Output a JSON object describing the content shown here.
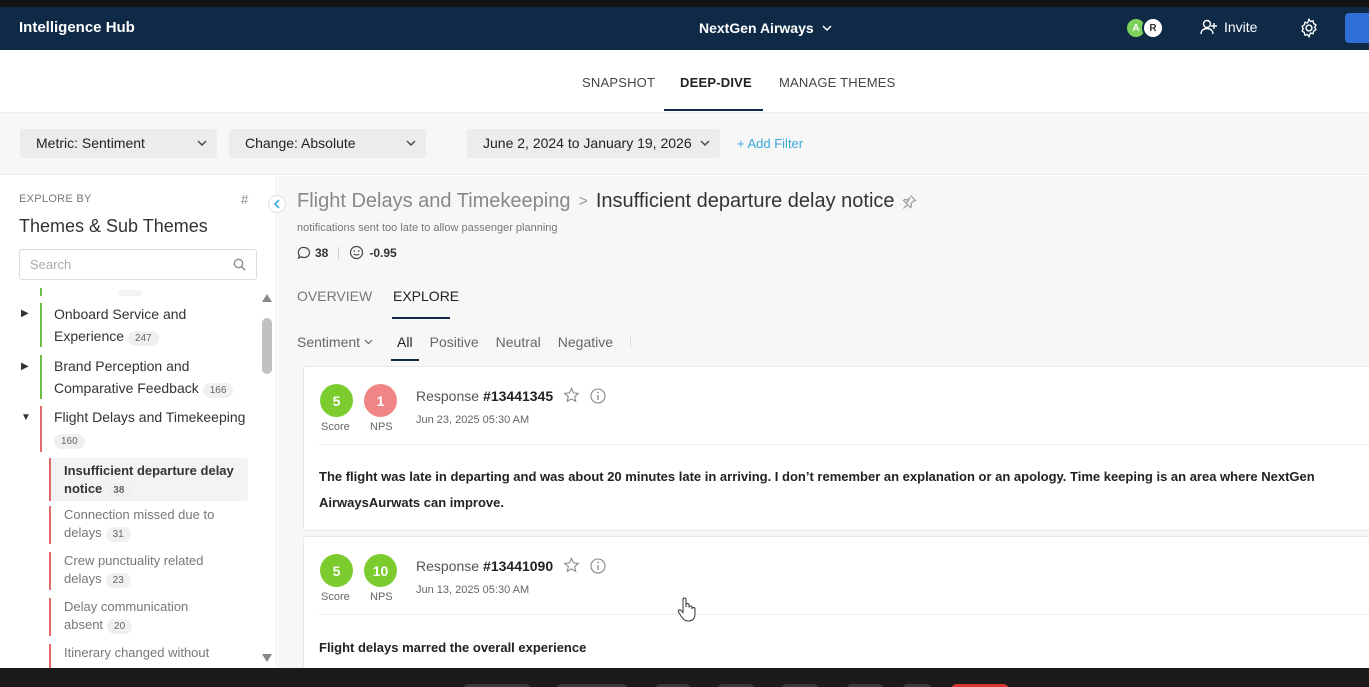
{
  "header": {
    "app_title": "Intelligence Hub",
    "org_name": "NextGen Airways",
    "avatars": [
      "A",
      "R"
    ],
    "invite_label": "Invite"
  },
  "nav": {
    "tabs": [
      "SNAPSHOT",
      "DEEP-DIVE",
      "MANAGE THEMES"
    ],
    "active_tab": "DEEP-DIVE"
  },
  "filters": {
    "metric": "Metric: Sentiment",
    "change": "Change: Absolute",
    "date_range": "June 2, 2024 to January 19, 2026",
    "add_filter": "+ Add Filter"
  },
  "sidebar": {
    "explore_by": "EXPLORE BY",
    "hash": "#",
    "title": "Themes & Sub Themes",
    "search_placeholder": "Search",
    "themes": [
      {
        "line1": "Onboard Service and",
        "line2": "Experience",
        "count": "247",
        "color": "green"
      },
      {
        "line1": "Brand Perception and",
        "line2": "Comparative Feedback",
        "count": "166",
        "color": "green"
      },
      {
        "line1": "Flight Delays and Timekeeping",
        "count": "160",
        "color": "red",
        "expanded": true
      }
    ],
    "subthemes": [
      {
        "line1": "Insufficient departure delay",
        "line2": "notice",
        "count": "38",
        "active": true
      },
      {
        "line1": "Connection missed due to",
        "line2": "delays",
        "count": "31"
      },
      {
        "line1": "Crew punctuality related",
        "line2": "delays",
        "count": "23"
      },
      {
        "line1": "Delay communication",
        "line2": "absent",
        "count": "20"
      },
      {
        "line1": "Itinerary changed without",
        "line2": "",
        "count": ""
      }
    ]
  },
  "main": {
    "breadcrumb_parent": "Flight Delays and Timekeeping",
    "breadcrumb_sep": ">",
    "breadcrumb_current": "Insufficient departure delay notice",
    "description": "notifications sent too late to allow passenger planning",
    "comment_count": "38",
    "sentiment_score": "-0.95",
    "subtabs": [
      "OVERVIEW",
      "EXPLORE"
    ],
    "active_subtab": "EXPLORE",
    "sentiment_dropdown": "Sentiment",
    "sentiment_filters": [
      "All",
      "Positive",
      "Neutral",
      "Negative"
    ],
    "active_filter": "All"
  },
  "responses": [
    {
      "score": "5",
      "score_label": "Score",
      "nps": "1",
      "nps_label": "NPS",
      "prefix": "Response",
      "id": "#13441345",
      "date": "Jun 23, 2025 05:30 AM",
      "text": "The flight was late in departing and was about 20 minutes late in arriving. I don’t remember an explanation or an apology. Time keeping is an area where NextGen AirwaysAurwats can improve."
    },
    {
      "score": "5",
      "score_label": "Score",
      "nps": "10",
      "nps_label": "NPS",
      "prefix": "Response",
      "id": "#13441090",
      "date": "Jun 13, 2025 05:30 AM",
      "text": "Flight delays marred the overall experience"
    }
  ]
}
